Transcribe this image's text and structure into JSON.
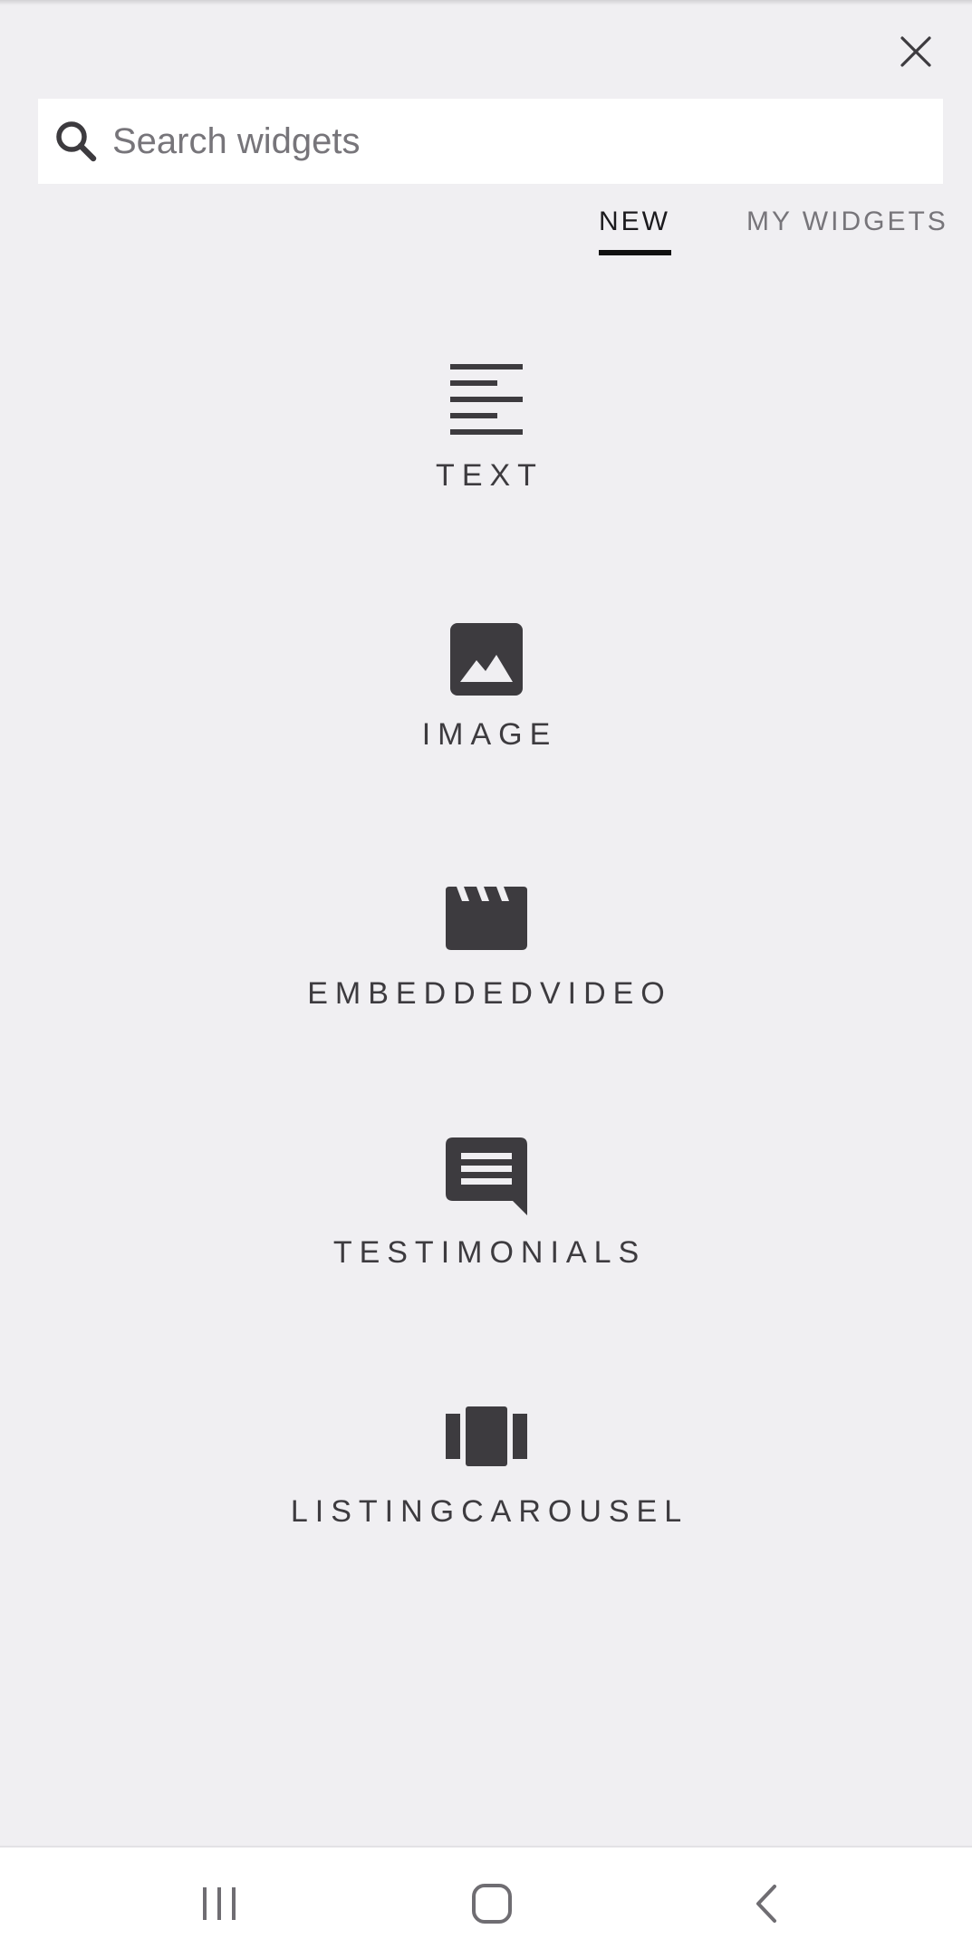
{
  "search": {
    "placeholder": "Search widgets",
    "value": ""
  },
  "tabs": [
    {
      "label": "NEW",
      "active": true
    },
    {
      "label": "MY WIDGETS",
      "active": false
    }
  ],
  "widgets": [
    {
      "label": "TEXT",
      "icon": "text-align-left-icon"
    },
    {
      "label": "IMAGE",
      "icon": "image-icon"
    },
    {
      "label": "EMBEDDEDVIDEO",
      "icon": "video-clapper-icon"
    },
    {
      "label": "TESTIMONIALS",
      "icon": "comment-icon"
    },
    {
      "label": "LISTINGCAROUSEL",
      "icon": "carousel-icon"
    }
  ],
  "colors": {
    "background": "#f0eff2",
    "icon": "#3d3b3f",
    "active_tab": "#1b1a1d",
    "inactive_tab": "#77757a"
  },
  "navigation": [
    "recent-apps-icon",
    "home-icon",
    "back-icon"
  ]
}
